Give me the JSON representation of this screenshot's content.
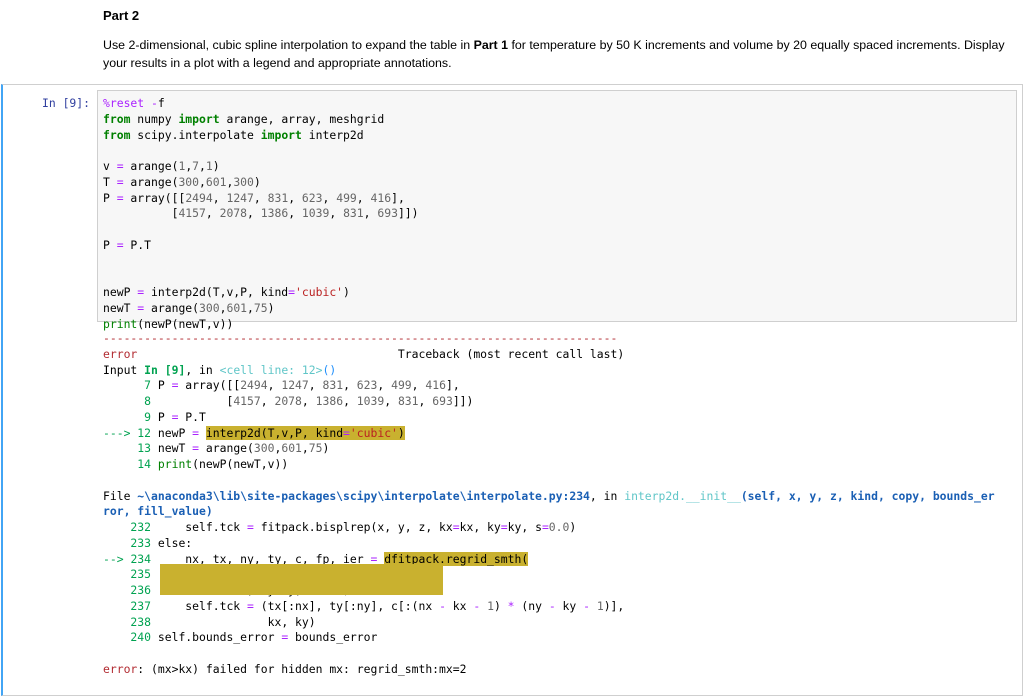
{
  "markdown": {
    "heading": "Part 2",
    "para_before": "Use 2-dimensional, cubic spline interpolation to expand the table in ",
    "para_bold": "Part 1",
    "para_after": " for temperature by 50 K increments and volume by 20 equally spaced increments. Display your results in a plot with a legend and appropriate annotations."
  },
  "cell": {
    "prompt": "In [9]:",
    "code_lines": [
      "%reset -f",
      "from numpy import arange, array, meshgrid",
      "from scipy.interpolate import interp2d",
      "",
      "v = arange(1,7,1)",
      "T = arange(300,601,300)",
      "P = array([[2494, 1247, 831, 623, 499, 416],",
      "          [4157, 2078, 1386, 1039, 831, 693]])",
      "",
      "P = P.T",
      "",
      "",
      "newP = interp2d(T,v,P, kind='cubic')",
      "newT = arange(300,601,75)",
      "print(newP(newT,v))"
    ]
  },
  "traceback": {
    "dashes": "---------------------------------------------------------------------------",
    "error_name": "error",
    "tb_title": "Traceback (most recent call last)",
    "input_label": "Input ",
    "input_in": "In [9]",
    "input_mid": ", in ",
    "input_cell": "<cell line: 12>",
    "input_end": "()",
    "frame1": [
      {
        "arrow": "      ",
        "num": "7",
        "text": " P = array([[2494, 1247, 831, 623, 499, 416],"
      },
      {
        "arrow": "      ",
        "num": "8",
        "text": "           [4157, 2078, 1386, 1039, 831, 693]])"
      },
      {
        "arrow": "      ",
        "num": "9",
        "text": " P = P.T"
      },
      {
        "arrow": "---> ",
        "num": "12",
        "pre": " newP = ",
        "hl": "interp2d(T,v,P, kind='cubic')"
      },
      {
        "arrow": "     ",
        "num": "13",
        "text": " newT = arange(300,601,75)"
      },
      {
        "arrow": "     ",
        "num": "14",
        "text": " print(newP(newT,v))"
      }
    ],
    "file_prefix": "File ",
    "file_path": "~\\anaconda3\\lib\\site-packages\\scipy\\interpolate\\interpolate.py:234",
    "file_mid": ", in ",
    "file_func": "interp2d.__init__",
    "file_args": "(self, x, y, z, kind, copy, bounds_error, fill_value)",
    "frame2": [
      {
        "arrow": "    ",
        "num": "232",
        "text": "     self.tck = fitpack.bisplrep(x, y, z, kx=kx, ky=ky, s=0.0)"
      },
      {
        "arrow": "    ",
        "num": "233",
        "text": " else:"
      },
      {
        "arrow": "--> ",
        "num": "234",
        "pre": "     nx, tx, ny, ty, c, fp, ier = ",
        "hl": "dfitpack.regrid_smth("
      },
      {
        "arrow": "    ",
        "num": "235",
        "hlfull": "         x, y, z, None, None, None, None,"
      },
      {
        "arrow": "    ",
        "num": "236",
        "hlfull": "         kx=kx, ky=ky, s=0.0)"
      },
      {
        "arrow": "    ",
        "num": "237",
        "text": "     self.tck = (tx[:nx], ty[:ny], c[:(nx - kx - 1) * (ny - ky - 1)],"
      },
      {
        "arrow": "    ",
        "num": "238",
        "text": "                 kx, ky)"
      },
      {
        "arrow": "    ",
        "num": "240",
        "text": " self.bounds_error = bounds_error"
      }
    ],
    "final_name": "error",
    "final_msg": ": (mx>kx) failed for hidden mx: regrid_smth:mx=2"
  }
}
